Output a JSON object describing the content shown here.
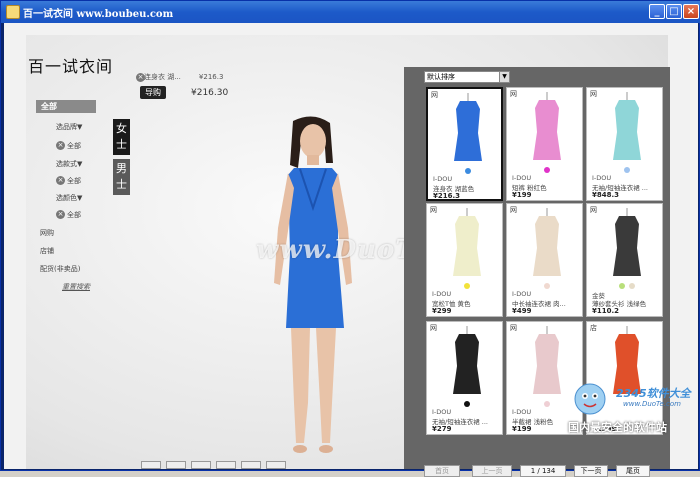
{
  "window": {
    "title": "百一试衣间  www.boubeu.com",
    "controls": {
      "minimize": "_",
      "maximize": "□",
      "close": "×"
    }
  },
  "header": {
    "logo": "百一试衣间",
    "cart": {
      "item_name": "连身衣 湖...",
      "item_price": "¥216.3",
      "buy_label": "导购",
      "total": "¥216.30"
    }
  },
  "sidebar": {
    "all_label": "全部",
    "filters": [
      {
        "label": "选品牌▼",
        "value": "全部"
      },
      {
        "label": "选款式▼",
        "value": "全部"
      },
      {
        "label": "选颜色▼",
        "value": "全部"
      }
    ],
    "links": [
      "网购",
      "店铺",
      "配货(非卖品)"
    ],
    "reset_label": "重置搜索"
  },
  "gender_tabs": [
    {
      "label": "女士",
      "active": true,
      "color": "#1a1a1a"
    },
    {
      "label": "男士",
      "active": false,
      "color": "#5a5a5a"
    }
  ],
  "watermark": "www.DuoTe.com",
  "panel": {
    "sort_label": "默认排序",
    "pager": {
      "first": "首页",
      "prev": "上一页",
      "page": "1 / 134",
      "next": "下一页",
      "last": "尾页"
    }
  },
  "products": [
    {
      "src": "网",
      "brand": "I-DOU",
      "name": "连身衣 湖蓝色",
      "price": "¥216.3",
      "colors": [
        "#3b8be0"
      ],
      "garment": "#2e6ed8",
      "selected": true
    },
    {
      "src": "网",
      "brand": "I-DOU",
      "name": "短裤 粉红色",
      "price": "¥199",
      "colors": [
        "#e033c8"
      ],
      "garment": "#e88dd0",
      "selected": false
    },
    {
      "src": "网",
      "brand": "I-DOU",
      "name": "无袖/短袖连衣裙 ...",
      "price": "¥848.3",
      "colors": [
        "#9fc3ef"
      ],
      "garment": "#8fd6d8",
      "selected": false
    },
    {
      "src": "网",
      "brand": "I-DOU",
      "name": "宽松T恤 黄色",
      "price": "¥299",
      "colors": [
        "#f2e23a"
      ],
      "garment": "#efeecb",
      "selected": false
    },
    {
      "src": "网",
      "brand": "I-DOU",
      "name": "中长袖连衣裙 肉...",
      "price": "¥499",
      "colors": [
        "#f0d9d0"
      ],
      "garment": "#eadbc8",
      "selected": false
    },
    {
      "src": "网",
      "brand": "金葵",
      "name": "薄纱套头衫 浅绿色",
      "price": "¥110.2",
      "colors": [
        "#b9df7b",
        "#e6dcc8"
      ],
      "garment": "#3a3a3a",
      "selected": false
    },
    {
      "src": "网",
      "brand": "I-DOU",
      "name": "无袖/短袖连衣裙 ...",
      "price": "¥279",
      "colors": [
        "#111111"
      ],
      "garment": "#222222",
      "selected": false
    },
    {
      "src": "网",
      "brand": "I-DOU",
      "name": "半截裙 浅粉色",
      "price": "¥199",
      "colors": [
        "#efcfd4"
      ],
      "garment": "#e8c9cc",
      "selected": false
    },
    {
      "src": "店",
      "brand": "",
      "name": "",
      "price": "¥1399",
      "colors": [],
      "garment": "#e0502a",
      "selected": false
    }
  ],
  "site_logo": {
    "title": "2345软件大全",
    "url": "www.DuoTe.com",
    "slogan": "国内最安全的软件站"
  }
}
